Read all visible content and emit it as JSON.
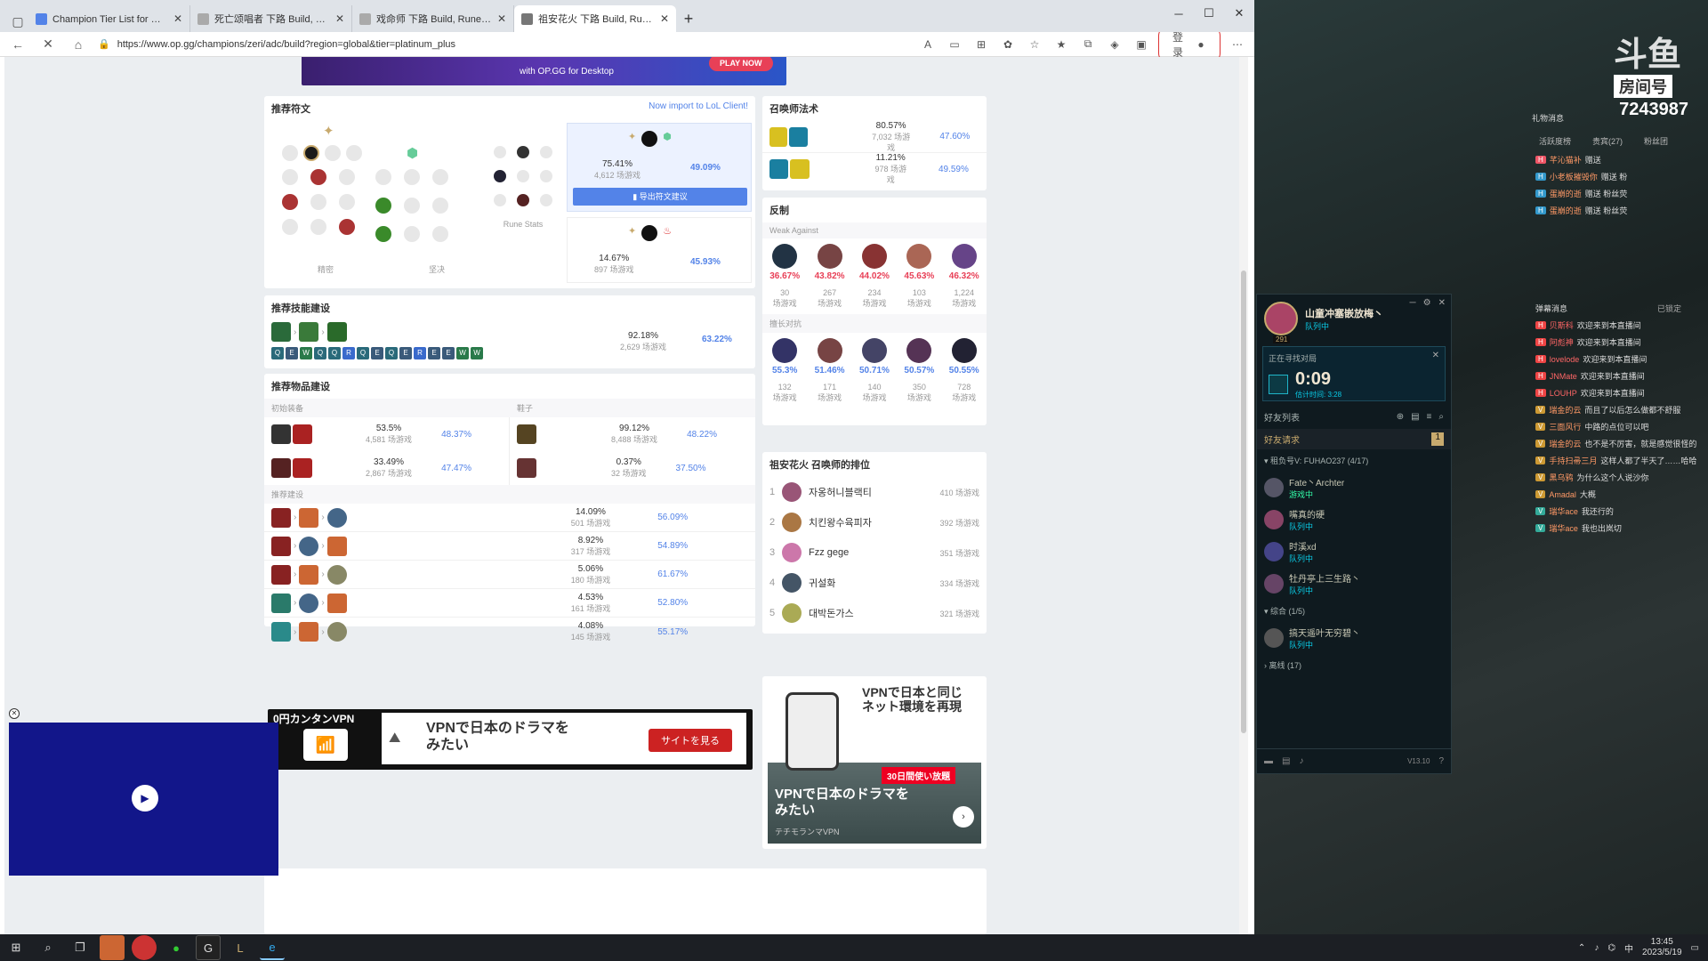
{
  "tabs": [
    {
      "title": "Champion Tier List for 下路, 华丽",
      "color": "#5383e8"
    },
    {
      "title": "死亡颂唱者 下路 Build, Runes, Co",
      "color": "#888"
    },
    {
      "title": "戏命师 下路 Build, Runes, Count",
      "color": "#888"
    },
    {
      "title": "祖安花火 下路 Build, Runes, Cou",
      "color": "#888"
    }
  ],
  "address": {
    "url": "https://www.op.gg/champions/zeri/adc/build?region=global&tier=platinum_plus",
    "login": "登录"
  },
  "banner": {
    "text": "with OP.GG for Desktop",
    "cta": "PLAY NOW"
  },
  "runes": {
    "title": "推荐符文",
    "import": "Now import to LoL Client!",
    "col1": "精密",
    "col2": "坚决",
    "col3": "Rune Stats",
    "export_btn": "导出符文建议",
    "builds": [
      {
        "pick": "75.41%",
        "games": "4,612 场游戏",
        "wr": "49.09%"
      },
      {
        "pick": "14.67%",
        "games": "897 场游戏",
        "wr": "45.93%"
      }
    ]
  },
  "spells": {
    "title": "召唤师法术",
    "rows": [
      {
        "pick": "80.57%",
        "games": "7,032 场游戏",
        "wr": "47.60%"
      },
      {
        "pick": "11.21%",
        "games": "978 场游戏",
        "wr": "49.59%"
      }
    ]
  },
  "counters": {
    "title": "反制",
    "weak_label": "Weak Against",
    "weak": [
      {
        "wr": "36.67%",
        "games": "30",
        "unit": "场游戏"
      },
      {
        "wr": "43.82%",
        "games": "267",
        "unit": "场游戏"
      },
      {
        "wr": "44.02%",
        "games": "234",
        "unit": "场游戏"
      },
      {
        "wr": "45.63%",
        "games": "103",
        "unit": "场游戏"
      },
      {
        "wr": "46.32%",
        "games": "1,224",
        "unit": "场游戏"
      }
    ],
    "strong_label": "擅长对抗",
    "strong": [
      {
        "wr": "55.3%",
        "games": "132",
        "unit": "场游戏"
      },
      {
        "wr": "51.46%",
        "games": "171",
        "unit": "场游戏"
      },
      {
        "wr": "50.71%",
        "games": "140",
        "unit": "场游戏"
      },
      {
        "wr": "50.57%",
        "games": "350",
        "unit": "场游戏"
      },
      {
        "wr": "50.55%",
        "games": "728",
        "unit": "场游戏"
      }
    ]
  },
  "skills": {
    "title": "推荐技能建设",
    "pick": "92.18%",
    "games": "2,629 场游戏",
    "wr": "63.22%",
    "order": [
      "Q",
      "E",
      "W",
      "Q",
      "Q",
      "R",
      "Q",
      "E",
      "Q",
      "E",
      "R",
      "E",
      "E",
      "W",
      "W"
    ]
  },
  "items": {
    "title": "推荐物品建设",
    "starter_label": "初始装备",
    "boots_label": "鞋子",
    "core_label": "推荐建设",
    "starters": [
      {
        "pick": "53.5%",
        "games": "4,581 场游戏",
        "wr": "48.37%"
      },
      {
        "pick": "33.49%",
        "games": "2,867 场游戏",
        "wr": "47.47%"
      }
    ],
    "boots": [
      {
        "pick": "99.12%",
        "games": "8,488 场游戏",
        "wr": "48.22%"
      },
      {
        "pick": "0.37%",
        "games": "32 场游戏",
        "wr": "37.50%"
      }
    ],
    "core": [
      {
        "pick": "14.09%",
        "games": "501 场游戏",
        "wr": "56.09%"
      },
      {
        "pick": "8.92%",
        "games": "317 场游戏",
        "wr": "54.89%"
      },
      {
        "pick": "5.06%",
        "games": "180 场游戏",
        "wr": "61.67%"
      },
      {
        "pick": "4.53%",
        "games": "161 场游戏",
        "wr": "52.80%"
      },
      {
        "pick": "4.08%",
        "games": "145 场游戏",
        "wr": "55.17%"
      }
    ]
  },
  "ranking": {
    "title": "祖安花火 召唤师的排位",
    "rows": [
      {
        "rank": "1",
        "name": "자옹허니블랙티",
        "games": "410 场游戏"
      },
      {
        "rank": "2",
        "name": "치킨왕수육피자",
        "games": "392 场游戏"
      },
      {
        "rank": "3",
        "name": "Fzz gege",
        "games": "351 场游戏"
      },
      {
        "rank": "4",
        "name": "귀설화",
        "games": "334 场游戏"
      },
      {
        "rank": "5",
        "name": "대박돈가스",
        "games": "321 场游戏"
      }
    ]
  },
  "ad_bottom": {
    "brand": "0円カンタンVPN",
    "text": "VPNで日本のドラマを\nみたい",
    "cta": "サイトを見る"
  },
  "ad_side": {
    "head": "VPNで日本と同じ\nネット環境を再現",
    "badge": "30日間使い放題",
    "body": "VPNで日本のドラマを\nみたい",
    "sub": "テチモランマVPN"
  },
  "stream": {
    "logo": "斗鱼",
    "room_label": "房间号",
    "room_id": "7243987",
    "gift_label": "礼物消息",
    "tabs": [
      "活跃度榜",
      "贵宾(27)",
      "粉丝团"
    ],
    "chat_title": "弹幕消息",
    "chat_label2": "已锁定"
  },
  "lol": {
    "user": "山童冲塞嵌放梅丶",
    "status": "队列中",
    "level": "291",
    "queue_title": "正在寻找对局",
    "timer": "0:09",
    "est": "估计时间: 3:28",
    "friends_title": "好友列表",
    "requests": "好友请求",
    "req_count": "1",
    "group1": "租负号V: FUHAO237 (4/17)",
    "group2": "综合 (1/5)",
    "group3": "离线 (17)",
    "version": "V13.10",
    "friends": [
      {
        "name": "Fate丶Archter",
        "status": "游戏中"
      },
      {
        "name": "嘴真的硬",
        "status": "队列中"
      },
      {
        "name": "时溪xd",
        "status": "队列中"
      },
      {
        "name": "牡丹亭上三生路丶",
        "status": "队列中"
      },
      {
        "name": "搞天遥叶无穷碧丶",
        "status": "队列中"
      }
    ]
  },
  "chat": [
    {
      "u": "芊沁猫补",
      "m": "赠送"
    },
    {
      "u": "小老板摧毁你",
      "m": "赠送 粉"
    },
    {
      "u": "蛋崩的逝",
      "m": "赠送 粉丝荧"
    },
    {
      "u": "蛋崩的逝",
      "m": "赠送 粉丝荧"
    },
    {
      "u": "贝斯科",
      "m": "欢迎来到本直播间"
    },
    {
      "u": "阿彪神",
      "m": "欢迎来到本直播间"
    },
    {
      "u": "lovelode",
      "m": "欢迎来到本直播间"
    },
    {
      "u": "JNMate",
      "m": "欢迎来到本直播间"
    },
    {
      "u": "LOUHP",
      "m": "欢迎来到本直播间"
    },
    {
      "u": "瑞金的云",
      "m": "而且了以后怎么做都不舒服"
    },
    {
      "u": "三面风行",
      "m": "中路的点位可以吧"
    },
    {
      "u": "瑞金的云",
      "m": "也不是不厉害，就是感觉很怪的"
    },
    {
      "u": "手持扫帚三月",
      "m": "这样人都了半天了……哈哈"
    },
    {
      "u": "黑乌鸦",
      "m": "为什么这个人说沙你"
    },
    {
      "u": "Amadal",
      "m": "大概"
    },
    {
      "u": "瑞华ace",
      "m": "我还行的"
    },
    {
      "u": "瑞华ace",
      "m": "我也出岚切"
    }
  ],
  "taskbar": {
    "time": "13:45",
    "date": "2023/5/19",
    "ime": "中"
  }
}
